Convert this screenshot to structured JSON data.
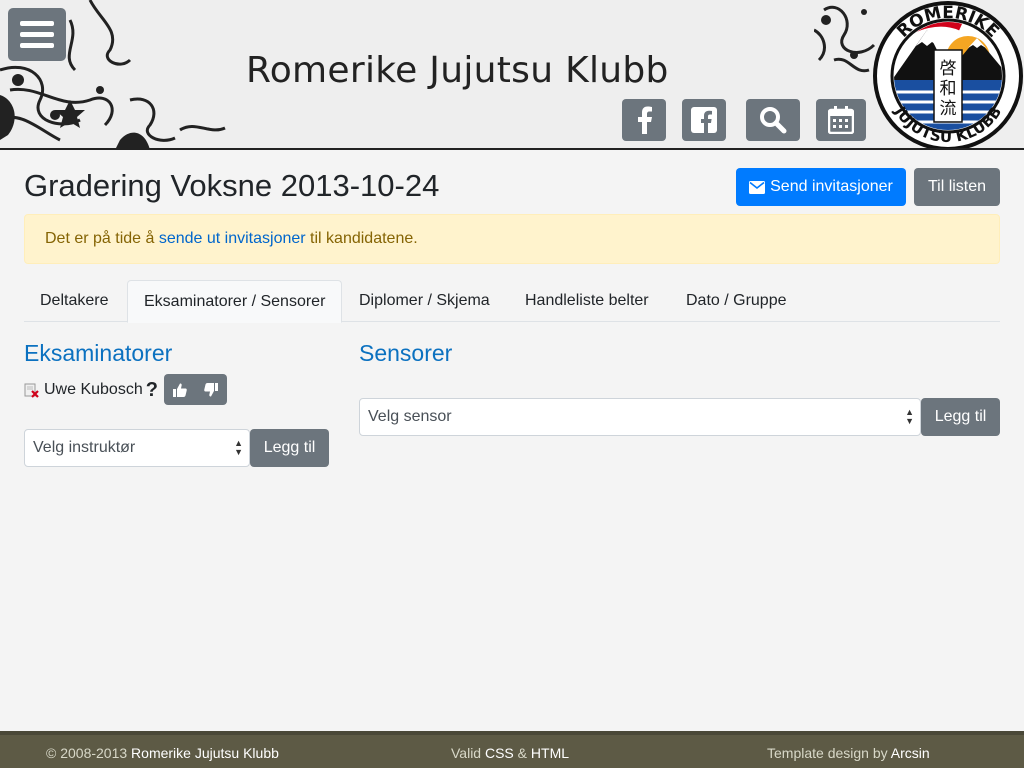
{
  "header": {
    "site_title": "Romerike Jujutsu Klubb",
    "menu_icon": "hamburger-icon",
    "social_icons": [
      "facebook-icon",
      "facebook-square-icon",
      "search-icon",
      "calendar-icon"
    ],
    "logo_text_top": "ROMERIKE",
    "logo_text_bottom": "JUJUTSU KLUBB",
    "logo_kanji": [
      "啓",
      "和",
      "流"
    ]
  },
  "page": {
    "title": "Gradering Voksne 2013-10-24",
    "send_invitations_label": "Send invitasjoner",
    "to_list_label": "Til listen"
  },
  "alert": {
    "prefix": "Det er på tide å ",
    "link": "sende ut invitasjoner",
    "suffix": " til kandidatene."
  },
  "tabs": [
    {
      "label": "Deltakere"
    },
    {
      "label": "Eksaminatorer / Sensorer"
    },
    {
      "label": "Diplomer / Skjema"
    },
    {
      "label": "Handleliste belter"
    },
    {
      "label": "Dato / Gruppe"
    }
  ],
  "examiners": {
    "heading": "Eksaminatorer",
    "items": [
      {
        "name": "Uwe Kubosch",
        "status": "?"
      }
    ],
    "select_placeholder": "Velg instruktør",
    "add_label": "Legg til"
  },
  "sensors": {
    "heading": "Sensorer",
    "select_placeholder": "Velg sensor",
    "add_label": "Legg til"
  },
  "footer": {
    "copyright": "© 2008-2013 ",
    "club": "Romerike Jujutsu Klubb",
    "valid_prefix": "Valid ",
    "css": "CSS",
    "amp": " & ",
    "html": "HTML",
    "template_prefix": "Template design by ",
    "designer": "Arcsin"
  },
  "colors": {
    "primary": "#007bff",
    "secondary": "#6c757d",
    "heading_blue": "#0b71c0",
    "alert_bg": "#fff3cd",
    "footer_bg": "#5d5a45"
  }
}
